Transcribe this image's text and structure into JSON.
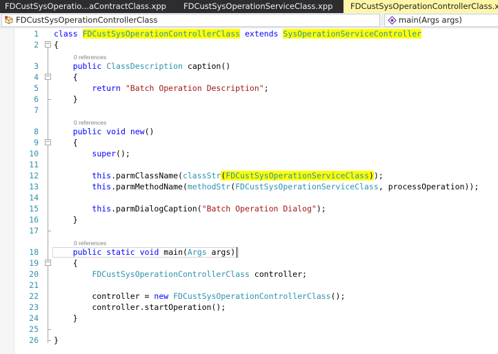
{
  "tabs": [
    {
      "label": "FDCustSysOperatio...aContractClass.xpp",
      "active": false
    },
    {
      "label": "FDCustSysOperationServiceClass.xpp",
      "active": false
    },
    {
      "label": "FDCustSysOperationControllerClass.xpp",
      "active": true
    }
  ],
  "nav": {
    "left_label": "FDCustSysOperationControllerClass",
    "left_icon": "class-icon",
    "right_label": "main(Args args)",
    "right_icon": "method-icon"
  },
  "colors": {
    "keyword": "#0000ff",
    "type": "#2b91af",
    "string": "#a31515",
    "line_number": "#2b91af",
    "highlight": "#ffff00",
    "active_tab": "#fff7a8",
    "tab_bar": "#2d2d30"
  },
  "editor": {
    "references_label": "0 references",
    "lines": [
      {
        "n": "1",
        "segs": [
          [
            "kw",
            "class"
          ],
          [
            "txt",
            " "
          ],
          [
            "ty-hl",
            "FDCustSysOperationControllerClass"
          ],
          [
            "txt",
            " "
          ],
          [
            "kw",
            "extends"
          ],
          [
            "txt",
            " "
          ],
          [
            "ty-hl",
            "SysOperationServiceController"
          ]
        ]
      },
      {
        "n": "2",
        "segs": [
          [
            "txt",
            "{"
          ]
        ]
      },
      {
        "n": "3",
        "segs": [
          [
            "txt",
            "    "
          ],
          [
            "kw",
            "public"
          ],
          [
            "txt",
            " "
          ],
          [
            "ty",
            "ClassDescription"
          ],
          [
            "txt",
            " caption()"
          ]
        ]
      },
      {
        "n": "4",
        "segs": [
          [
            "txt",
            "    {"
          ]
        ]
      },
      {
        "n": "5",
        "segs": [
          [
            "txt",
            "        "
          ],
          [
            "kw",
            "return"
          ],
          [
            "txt",
            " "
          ],
          [
            "st",
            "\"Batch Operation Description\""
          ],
          [
            "txt",
            ";"
          ]
        ]
      },
      {
        "n": "6",
        "segs": [
          [
            "txt",
            "    }"
          ]
        ]
      },
      {
        "n": "7",
        "segs": []
      },
      {
        "n": "8",
        "segs": [
          [
            "txt",
            "    "
          ],
          [
            "kw",
            "public"
          ],
          [
            "txt",
            " "
          ],
          [
            "kw",
            "void"
          ],
          [
            "txt",
            " "
          ],
          [
            "kw",
            "new"
          ],
          [
            "txt",
            "()"
          ]
        ]
      },
      {
        "n": "9",
        "segs": [
          [
            "txt",
            "    {"
          ]
        ]
      },
      {
        "n": "10",
        "segs": [
          [
            "txt",
            "        "
          ],
          [
            "kw",
            "super"
          ],
          [
            "txt",
            "();"
          ]
        ]
      },
      {
        "n": "11",
        "segs": []
      },
      {
        "n": "12",
        "segs": [
          [
            "txt",
            "        "
          ],
          [
            "kw",
            "this"
          ],
          [
            "txt",
            ".parmClassName("
          ],
          [
            "ty",
            "classStr"
          ],
          [
            "hl",
            "("
          ],
          [
            "ty-hl",
            "FDCustSysOperationServiceClass"
          ],
          [
            "hl",
            ")"
          ],
          [
            "txt",
            ");"
          ]
        ]
      },
      {
        "n": "13",
        "segs": [
          [
            "txt",
            "        "
          ],
          [
            "kw",
            "this"
          ],
          [
            "txt",
            ".parmMethodName("
          ],
          [
            "ty",
            "methodStr"
          ],
          [
            "txt",
            "("
          ],
          [
            "ty",
            "FDCustSysOperationServiceClass"
          ],
          [
            "txt",
            ", processOperation));"
          ]
        ]
      },
      {
        "n": "14",
        "segs": []
      },
      {
        "n": "15",
        "segs": [
          [
            "txt",
            "        "
          ],
          [
            "kw",
            "this"
          ],
          [
            "txt",
            ".parmDialogCaption("
          ],
          [
            "st",
            "\"Batch Operation Dialog\""
          ],
          [
            "txt",
            ");"
          ]
        ]
      },
      {
        "n": "16",
        "segs": [
          [
            "txt",
            "    }"
          ]
        ]
      },
      {
        "n": "17",
        "segs": []
      },
      {
        "n": "18",
        "segs": [
          [
            "txt",
            "    "
          ],
          [
            "kw",
            "public"
          ],
          [
            "txt",
            " "
          ],
          [
            "kw",
            "static"
          ],
          [
            "txt",
            " "
          ],
          [
            "kw",
            "void"
          ],
          [
            "txt",
            " main("
          ],
          [
            "ty",
            "Args"
          ],
          [
            "txt",
            " args)"
          ]
        ]
      },
      {
        "n": "19",
        "segs": [
          [
            "txt",
            "    {"
          ]
        ]
      },
      {
        "n": "20",
        "segs": [
          [
            "txt",
            "        "
          ],
          [
            "ty",
            "FDCustSysOperationControllerClass"
          ],
          [
            "txt",
            " controller;"
          ]
        ]
      },
      {
        "n": "21",
        "segs": []
      },
      {
        "n": "22",
        "segs": [
          [
            "txt",
            "        controller = "
          ],
          [
            "kw",
            "new"
          ],
          [
            "txt",
            " "
          ],
          [
            "ty",
            "FDCustSysOperationControllerClass"
          ],
          [
            "txt",
            "();"
          ]
        ]
      },
      {
        "n": "23",
        "segs": [
          [
            "txt",
            "        controller.startOperation();"
          ]
        ]
      },
      {
        "n": "24",
        "segs": [
          [
            "txt",
            "    }"
          ]
        ]
      },
      {
        "n": "25",
        "segs": []
      },
      {
        "n": "26",
        "segs": [
          [
            "txt",
            "}"
          ]
        ]
      }
    ]
  }
}
